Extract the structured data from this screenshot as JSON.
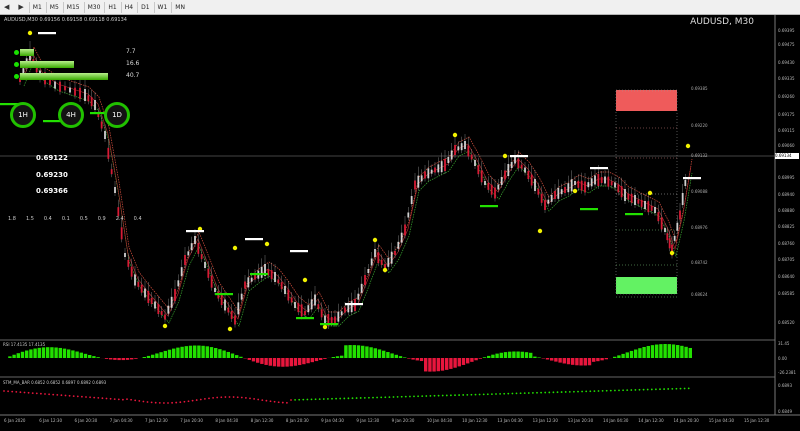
{
  "toolbar": {
    "nav": [
      "◀",
      "▶"
    ],
    "timeframes": [
      "M1",
      "M5",
      "M15",
      "M30",
      "H1",
      "H4",
      "D1",
      "W1",
      "MN"
    ]
  },
  "chart": {
    "symbol_line": "AUDUSD,M30  0.69156 0.69158 0.69118 0.69134",
    "window_title": "AUDUSD, M30",
    "current_price": "0.69134"
  },
  "ma_panel": {
    "rows": [
      {
        "text": "",
        "value": "7.7",
        "fill": 0.12
      },
      {
        "text": "",
        "value": "16.6",
        "fill": 0.48
      },
      {
        "text": "",
        "value": "40.7",
        "fill": 0.78
      }
    ]
  },
  "timeframe_circles": [
    {
      "label": "1H"
    },
    {
      "label": "4H"
    },
    {
      "label": "1D"
    }
  ],
  "levels": {
    "level1": "0.69122",
    "level2": "0.69230",
    "level3": "0.69366"
  },
  "stats": [
    "1.8",
    "1.5",
    "0.4",
    "0.1",
    "0.5",
    "0.9",
    "2.4",
    "0.4"
  ],
  "price_axis": [
    "0.69395",
    "0.69475",
    "0.69430",
    "0.69335",
    "0.69260",
    "0.69175",
    "0.69115",
    "0.69060",
    "0.68995",
    "0.68940",
    "0.68880",
    "0.68825",
    "0.68760",
    "0.68705",
    "0.68640",
    "0.68585",
    "0.68520"
  ],
  "zone_labels": [
    "0.69385",
    "0.69220",
    "0.69132",
    "0.69088",
    "0.68976",
    "0.68742",
    "0.68624"
  ],
  "rsi": {
    "label": "RSI 17.4135 17.4135",
    "axis": [
      "31.45",
      "0.00",
      "-26.2381"
    ]
  },
  "stm": {
    "label": "STM_MA_BAR 0.6852 0.6852 0.6897 0.6892 0.6893",
    "axis": [
      "0.6893",
      "0.6849"
    ]
  },
  "time_axis": [
    "6 Jan 2020",
    "6 Jan 12:30",
    "6 Jan 20:30",
    "7 Jan 04:30",
    "7 Jan 12:30",
    "7 Jan 20:30",
    "8 Jan 04:30",
    "8 Jan 12:30",
    "8 Jan 20:30",
    "9 Jan 04:30",
    "9 Jan 12:30",
    "9 Jan 20:30",
    "10 Jan 04:30",
    "10 Jan 12:30",
    "13 Jan 04:30",
    "13 Jan 12:30",
    "13 Jan 20:30",
    "14 Jan 04:30",
    "14 Jan 12:30",
    "14 Jan 20:30",
    "15 Jan 04:30",
    "15 Jan 12:30"
  ],
  "colors": {
    "bull": "#22e000",
    "bear": "#e8163d",
    "band": "#d7503f",
    "signal_dot": "#f2f200",
    "sell_zone": "#ef5b5b",
    "buy_zone": "#63f263"
  }
}
